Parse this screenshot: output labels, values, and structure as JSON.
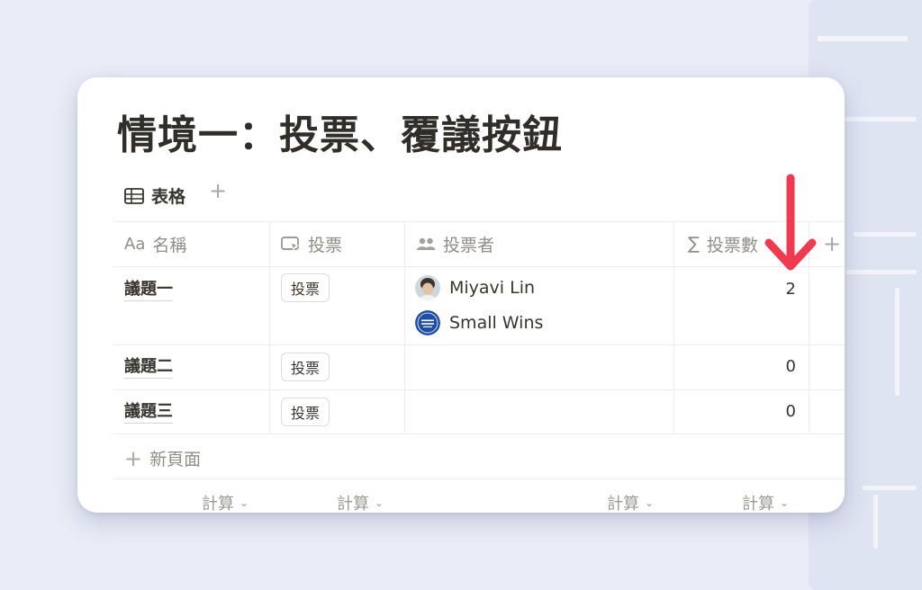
{
  "page": {
    "title": "情境一：投票、覆議按鈕",
    "view_tab_label": "表格",
    "add_view": "+"
  },
  "columns": [
    {
      "label": "名稱",
      "icon": "text-icon",
      "icon_text": "Aa"
    },
    {
      "label": "投票",
      "icon": "button-icon"
    },
    {
      "label": "投票者",
      "icon": "people-icon"
    },
    {
      "label": "投票數",
      "icon": "sigma-icon",
      "icon_text": "∑"
    }
  ],
  "add_column": "+",
  "rows": [
    {
      "name": "議題一",
      "button": "投票",
      "voters": [
        "Miyavi Lin",
        "Small Wins"
      ],
      "count": "2"
    },
    {
      "name": "議題二",
      "button": "投票",
      "voters": [],
      "count": "0"
    },
    {
      "name": "議題三",
      "button": "投票",
      "voters": [],
      "count": "0"
    }
  ],
  "new_page_label": "新頁面",
  "calc_label": "計算",
  "colors": {
    "arrow": "#f03a4f",
    "accent_blue": "#1e4fa8"
  }
}
